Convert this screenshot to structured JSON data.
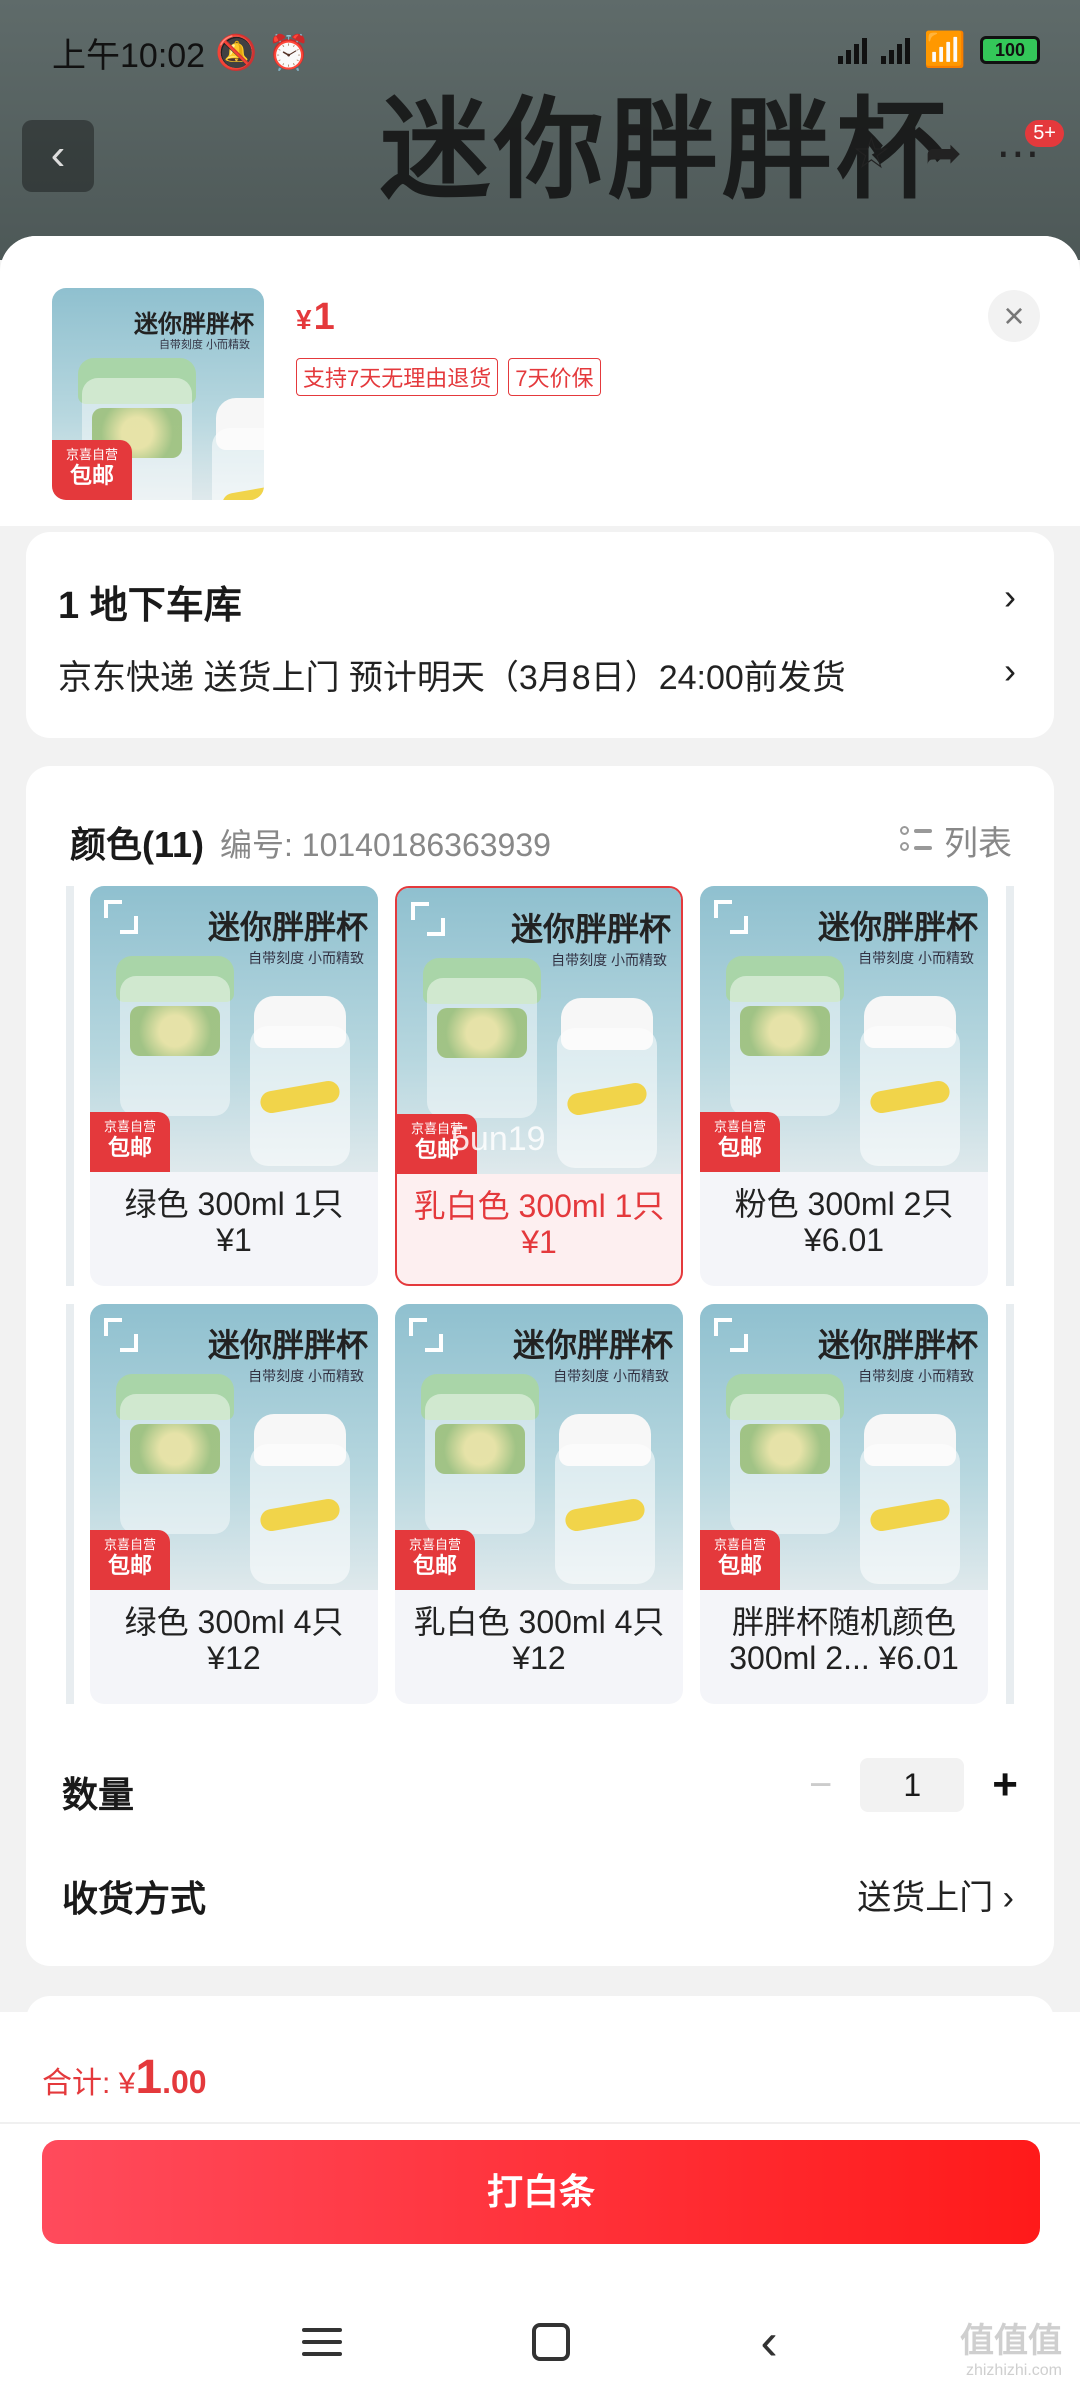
{
  "status_bar": {
    "time": "上午10:02",
    "battery": "100"
  },
  "header": {
    "banner": "迷你胖胖杯",
    "badge": "5+"
  },
  "product": {
    "price": "1",
    "currency": "¥",
    "tags": [
      "支持7天无理由退货",
      "7天价保"
    ],
    "thumb_title": "迷你胖胖杯",
    "thumb_sub": "自带刻度 小而精致",
    "stamp_top": "京喜自营",
    "stamp_bottom": "包邮"
  },
  "address": {
    "line1": "1  地下车库",
    "line2": "京东快递 送货上门 预计明天（3月8日）24:00前发货"
  },
  "spec": {
    "title": "颜色(11)",
    "code": "编号: 10140186363939",
    "list_label": "列表",
    "items": [
      {
        "line1": "绿色 300ml 1只",
        "line2": "¥1",
        "selected": false
      },
      {
        "line1": "乳白色 300ml 1只",
        "line2": "¥1",
        "selected": true
      },
      {
        "line1": "粉色 300ml 2只",
        "line2": "¥6.01",
        "selected": false
      },
      {
        "line1": "绿色 300ml 4只",
        "line2": "¥12",
        "selected": false
      },
      {
        "line1": "乳白色 300ml 4只",
        "line2": "¥12",
        "selected": false
      },
      {
        "line1": "胖胖杯随机颜色",
        "line2": "300ml 2...  ¥6.01",
        "selected": false
      }
    ],
    "watermark_text": "5un19"
  },
  "quantity": {
    "label": "数量",
    "value": "1",
    "minus": "−",
    "plus": "+"
  },
  "shipping": {
    "label": "收货方式",
    "value": "送货上门"
  },
  "footer": {
    "total_label": "合计: ",
    "currency": "¥",
    "total_int": "1",
    "total_dec": ".00",
    "buy_label": "打白条"
  },
  "watermark": {
    "title": "值值值",
    "url": "zhizhizhi.com"
  },
  "colors": {
    "accent": "#e4393c"
  }
}
